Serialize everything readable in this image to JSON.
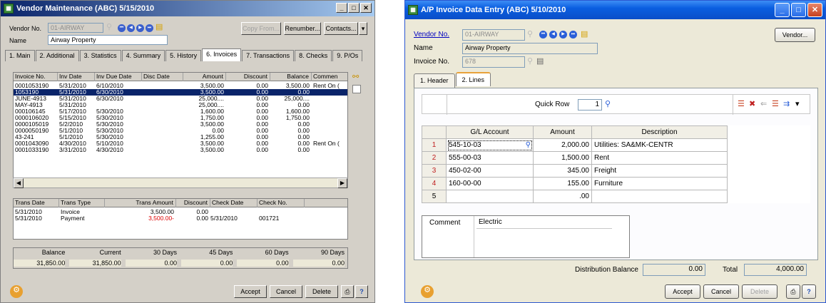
{
  "vm": {
    "title": "Vendor Maintenance (ABC) 5/15/2010",
    "vendor_no_label": "Vendor No.",
    "vendor_no": "01-AIRWAY",
    "name_label": "Name",
    "name": "Airway Property",
    "copy_from": "Copy From...",
    "renumber": "Renumber...",
    "contacts": "Contacts...",
    "tabs": [
      "1. Main",
      "2. Additional",
      "3. Statistics",
      "4. Summary",
      "5. History",
      "6. Invoices",
      "7. Transactions",
      "8. Checks",
      "9. P/Os"
    ],
    "inv_headers": [
      "Invoice No.",
      "Inv Date",
      "Inv Due Date",
      "Disc Date",
      "Amount",
      "Discount",
      "Balance",
      "Commen"
    ],
    "invoices": [
      [
        "0001053190",
        "5/31/2010",
        "6/10/2010",
        "",
        "3,500.00",
        "0.00",
        "3,500.00",
        "Rent On ("
      ],
      [
        "1053190",
        "5/31/2010",
        "6/30/2010",
        "",
        "3,500.00",
        "0.00",
        "0.00",
        ""
      ],
      [
        "JUNE-4913",
        "5/31/2010",
        "6/30/2010",
        "",
        "25,000....",
        "0.00",
        "25,000....",
        ""
      ],
      [
        "MAY-4913",
        "5/31/2010",
        "",
        "",
        "25,000....",
        "0.00",
        "0.00",
        ""
      ],
      [
        "000106145",
        "5/17/2010",
        "5/30/2010",
        "",
        "1,600.00",
        "0.00",
        "1,600.00",
        ""
      ],
      [
        "0000106020",
        "5/15/2010",
        "5/30/2010",
        "",
        "1,750.00",
        "0.00",
        "1,750.00",
        ""
      ],
      [
        "0000105019",
        "5/2/2010",
        "5/30/2010",
        "",
        "3,500.00",
        "0.00",
        "0.00",
        ""
      ],
      [
        "0000050190",
        "5/1/2010",
        "5/30/2010",
        "",
        "0.00",
        "0.00",
        "0.00",
        ""
      ],
      [
        "43-241",
        "5/1/2010",
        "5/30/2010",
        "",
        "1,255.00",
        "0.00",
        "0.00",
        ""
      ],
      [
        "0001043090",
        "4/30/2010",
        "5/10/2010",
        "",
        "3,500.00",
        "0.00",
        "0.00",
        "Rent On ("
      ],
      [
        "0001033190",
        "3/31/2010",
        "4/30/2010",
        "",
        "3,500.00",
        "0.00",
        "0.00",
        ""
      ]
    ],
    "trans_headers": [
      "Trans Date",
      "Trans Type",
      "Trans Amount",
      "Discount",
      "Check Date",
      "Check No."
    ],
    "trans": [
      [
        "5/31/2010",
        "Invoice",
        "3,500.00",
        "0.00",
        "",
        ""
      ],
      [
        "5/31/2010",
        "Payment",
        "3,500.00-",
        "0.00",
        "5/31/2010",
        "001721"
      ]
    ],
    "aging_headers": [
      "Balance",
      "Current",
      "30 Days",
      "45 Days",
      "60 Days",
      "90 Days"
    ],
    "aging": [
      "31,850.00",
      "31,850.00",
      "0.00",
      "0.00",
      "0.00",
      "0.00"
    ],
    "accept": "Accept",
    "cancel": "Cancel",
    "delete": "Delete"
  },
  "ap": {
    "title": "A/P Invoice Data Entry (ABC) 5/10/2010",
    "vendor_no_label": "Vendor No.",
    "vendor_no": "01-AIRWAY",
    "name_label": "Name",
    "name": "Airway Property",
    "invoice_no_label": "Invoice No.",
    "invoice_no": "678",
    "vendor_btn": "Vendor...",
    "tabs": [
      "1. Header",
      "2. Lines"
    ],
    "quick_row_label": "Quick Row",
    "quick_row": "1",
    "headers": [
      "G/L Account",
      "Amount",
      "Description"
    ],
    "lines": [
      {
        "n": "1",
        "acct": "545-10-03",
        "amt": "2,000.00",
        "desc": "Utilities: SA&MK-CENTR"
      },
      {
        "n": "2",
        "acct": "555-00-03",
        "amt": "1,500.00",
        "desc": "Rent"
      },
      {
        "n": "3",
        "acct": "450-02-00",
        "amt": "345.00",
        "desc": "Freight"
      },
      {
        "n": "4",
        "acct": "160-00-00",
        "amt": "155.00",
        "desc": "Furniture"
      },
      {
        "n": "5",
        "acct": "",
        "amt": ".00",
        "desc": ""
      }
    ],
    "comment_label": "Comment",
    "comment": "Electric",
    "dist_label": "Distribution Balance",
    "dist": "0.00",
    "total_label": "Total",
    "total": "4,000.00",
    "accept": "Accept",
    "cancel": "Cancel",
    "delete": "Delete"
  }
}
